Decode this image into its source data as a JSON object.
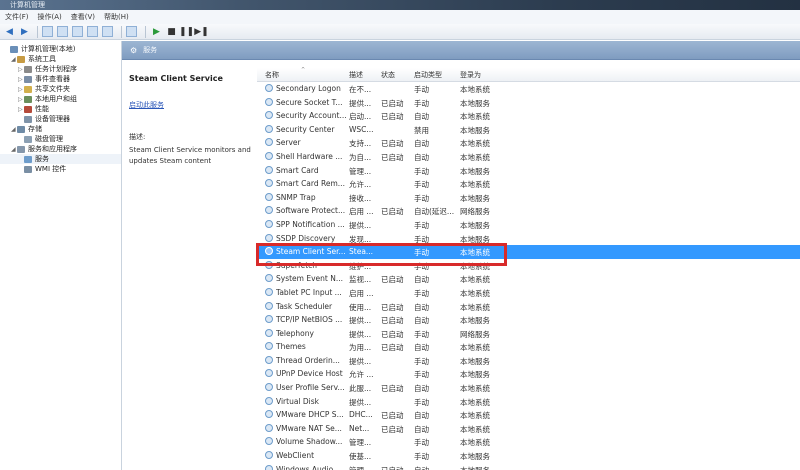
{
  "window": {
    "title": "计算机管理"
  },
  "menu": [
    "文件(F)",
    "操作(A)",
    "查看(V)",
    "帮助(H)"
  ],
  "toolbar": {
    "icons": [
      "back-icon",
      "forward-icon",
      "up-icon",
      "show-hide-tree-icon",
      "properties-icon",
      "refresh-icon",
      "export-icon",
      "help-icon",
      "start-service-icon",
      "stop-service-icon",
      "pause-service-icon",
      "restart-service-icon"
    ]
  },
  "tree": [
    {
      "label": "计算机管理(本地)",
      "depth": 0,
      "twisty": "",
      "icon_color": "#6a8fb8"
    },
    {
      "label": "系统工具",
      "depth": 1,
      "twisty": "◢",
      "icon_color": "#c79b43"
    },
    {
      "label": "任务计划程序",
      "depth": 2,
      "twisty": "▷",
      "icon_color": "#8a8a8a"
    },
    {
      "label": "事件查看器",
      "depth": 2,
      "twisty": "▷",
      "icon_color": "#7b8ea6"
    },
    {
      "label": "共享文件夹",
      "depth": 2,
      "twisty": "▷",
      "icon_color": "#d2b04c"
    },
    {
      "label": "本地用户和组",
      "depth": 2,
      "twisty": "▷",
      "icon_color": "#6b8f5c"
    },
    {
      "label": "性能",
      "depth": 2,
      "twisty": "▷",
      "icon_color": "#b54a3a"
    },
    {
      "label": "设备管理器",
      "depth": 2,
      "twisty": "",
      "icon_color": "#7f93a8"
    },
    {
      "label": "存储",
      "depth": 1,
      "twisty": "◢",
      "icon_color": "#6f8ba6"
    },
    {
      "label": "磁盘管理",
      "depth": 2,
      "twisty": "",
      "icon_color": "#8ca0b3"
    },
    {
      "label": "服务和应用程序",
      "depth": 1,
      "twisty": "◢",
      "icon_color": "#8597ab"
    },
    {
      "label": "服务",
      "depth": 2,
      "twisty": "",
      "icon_color": "#6d9ccb"
    },
    {
      "label": "WMI 控件",
      "depth": 2,
      "twisty": "",
      "icon_color": "#7a8fa4"
    }
  ],
  "panel": {
    "title": "服务"
  },
  "description": {
    "service_name": "Steam Client Service",
    "link": "启动此服务",
    "label": "描述:",
    "text": "Steam Client Service monitors and updates Steam content"
  },
  "table": {
    "columns": [
      "名称",
      "描述",
      "状态",
      "启动类型",
      "登录为"
    ],
    "rows": [
      [
        "Secondary Logon",
        "在不...",
        "",
        "手动",
        "本地系统"
      ],
      [
        "Secure Socket T...",
        "提供...",
        "已启动",
        "手动",
        "本地服务"
      ],
      [
        "Security Account...",
        "启动...",
        "已启动",
        "自动",
        "本地系统"
      ],
      [
        "Security Center",
        "WSC...",
        "",
        "禁用",
        "本地服务"
      ],
      [
        "Server",
        "支持...",
        "已启动",
        "自动",
        "本地系统"
      ],
      [
        "Shell Hardware ...",
        "为自...",
        "已启动",
        "自动",
        "本地系统"
      ],
      [
        "Smart Card",
        "管理...",
        "",
        "手动",
        "本地服务"
      ],
      [
        "Smart Card Rem...",
        "允许...",
        "",
        "手动",
        "本地系统"
      ],
      [
        "SNMP Trap",
        "接收...",
        "",
        "手动",
        "本地服务"
      ],
      [
        "Software Protect...",
        "启用 ...",
        "已启动",
        "自动(延迟...",
        "网络服务"
      ],
      [
        "SPP Notification ...",
        "提供...",
        "",
        "手动",
        "本地服务"
      ],
      [
        "SSDP Discovery",
        "发现...",
        "",
        "手动",
        "本地服务"
      ],
      [
        "Steam Client Ser...",
        "Stea...",
        "",
        "手动",
        "本地系统"
      ],
      [
        "Superfetch",
        "维护...",
        "",
        "手动",
        "本地系统"
      ],
      [
        "System Event N...",
        "监视...",
        "已启动",
        "自动",
        "本地系统"
      ],
      [
        "Tablet PC Input ...",
        "启用 ...",
        "",
        "手动",
        "本地系统"
      ],
      [
        "Task Scheduler",
        "使用...",
        "已启动",
        "自动",
        "本地系统"
      ],
      [
        "TCP/IP NetBIOS ...",
        "提供...",
        "已启动",
        "自动",
        "本地服务"
      ],
      [
        "Telephony",
        "提供...",
        "已启动",
        "手动",
        "网络服务"
      ],
      [
        "Themes",
        "为用...",
        "已启动",
        "自动",
        "本地系统"
      ],
      [
        "Thread Orderin...",
        "提供...",
        "",
        "手动",
        "本地服务"
      ],
      [
        "UPnP Device Host",
        "允许 ...",
        "",
        "手动",
        "本地服务"
      ],
      [
        "User Profile Serv...",
        "此服...",
        "已启动",
        "自动",
        "本地系统"
      ],
      [
        "Virtual Disk",
        "提供...",
        "",
        "手动",
        "本地系统"
      ],
      [
        "VMware DHCP S...",
        "DHC...",
        "已启动",
        "自动",
        "本地系统"
      ],
      [
        "VMware NAT Se...",
        "Net...",
        "已启动",
        "自动",
        "本地系统"
      ],
      [
        "Volume Shadow...",
        "管理...",
        "",
        "手动",
        "本地系统"
      ],
      [
        "WebClient",
        "使基...",
        "",
        "手动",
        "本地服务"
      ],
      [
        "Windows Audio",
        "管理...",
        "已启动",
        "自动",
        "本地服务"
      ]
    ],
    "selected_index": 12
  },
  "colors": {
    "selection": "#3399ff",
    "highlight_box": "#d82a2a"
  }
}
